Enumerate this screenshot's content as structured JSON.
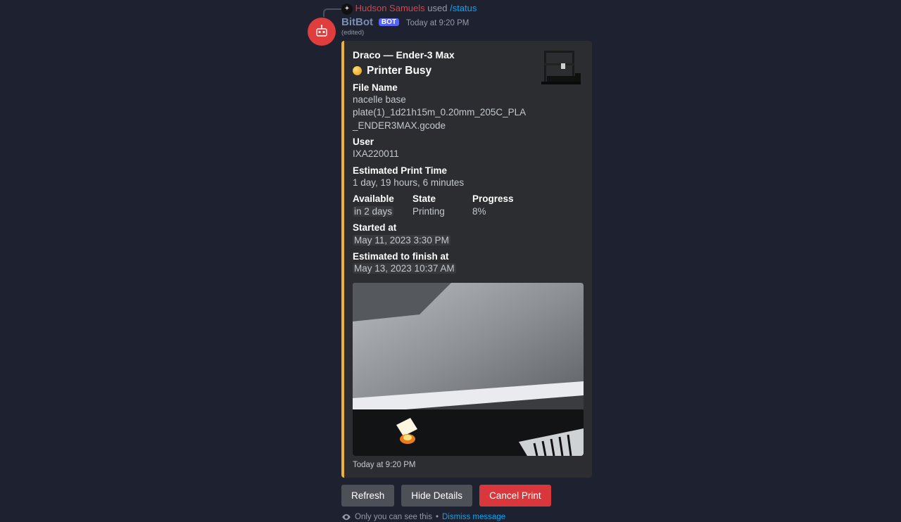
{
  "command": {
    "user": "Hudson Samuels",
    "used_text": "used",
    "slash_command": "/status"
  },
  "message": {
    "bot_name": "BitBot",
    "bot_tag": "BOT",
    "timestamp": "Today at 9:20 PM",
    "edited": "(edited)"
  },
  "embed": {
    "title": "Draco — Ender-3 Max",
    "status": "Printer Busy",
    "fields": {
      "filename_label": "File Name",
      "filename_value": "nacelle base plate(1)_1d21h15m_0.20mm_205C_PLA_ENDER3MAX.gcode",
      "user_label": "User",
      "user_value": "IXA220011",
      "eta_label": "Estimated Print Time",
      "eta_value": "1 day, 19 hours, 6 minutes",
      "available_label": "Available",
      "available_value": "in 2 days",
      "state_label": "State",
      "state_value": "Printing",
      "progress_label": "Progress",
      "progress_value": "8%",
      "started_label": "Started at",
      "started_value": "May 11, 2023 3:30 PM",
      "finish_label": "Estimated to finish at",
      "finish_value": "May 13, 2023 10:37 AM"
    },
    "footer": "Today at 9:20 PM"
  },
  "buttons": {
    "refresh": "Refresh",
    "hide": "Hide Details",
    "cancel": "Cancel Print"
  },
  "ephemeral": {
    "text": "Only you can see this",
    "sep": "•",
    "dismiss": "Dismiss message"
  }
}
